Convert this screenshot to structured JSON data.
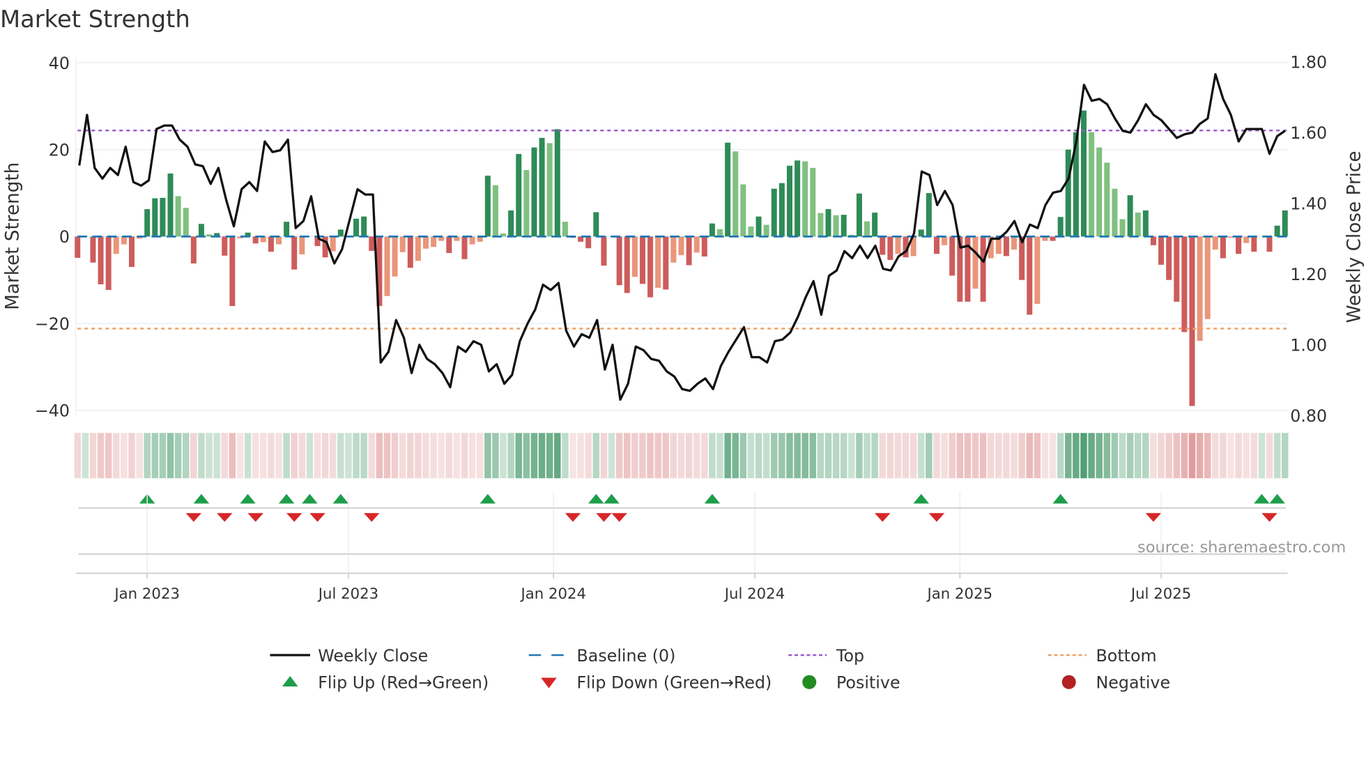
{
  "chart_data": {
    "type": "bar",
    "title": "Market Strength",
    "ylabel": "Market Strength",
    "y2label": "Weekly Close Price",
    "ylim": [
      -40,
      40
    ],
    "y2lim": [
      0.8,
      1.8
    ],
    "yticks": [
      40,
      20,
      0,
      -20,
      -40
    ],
    "ytick_labels": [
      "40",
      "20",
      "0",
      "−20",
      "−40"
    ],
    "y2ticks": [
      1.8,
      1.6,
      1.4,
      1.2,
      1.0,
      0.8
    ],
    "y2tick_labels": [
      "1.80",
      "1.60",
      "1.40",
      "1.20",
      "1.00",
      "0.80"
    ],
    "xtick_labels": [
      "Jan 2023",
      "Jul 2023",
      "Jan 2024",
      "Jul 2024",
      "Jan 2025",
      "Jul 2025"
    ],
    "xtick_week_index": [
      9,
      35,
      61.5,
      87.5,
      114,
      140
    ],
    "top_line": 24.4,
    "bottom_line": -21.2,
    "baseline": 0,
    "strength": [
      -4.9,
      0,
      -6,
      -11,
      -12.3,
      -4,
      -1.8,
      -7,
      -0.5,
      6.3,
      8.8,
      8.9,
      14.5,
      9.3,
      6.6,
      -6.2,
      2.9,
      0.5,
      0.8,
      -4.4,
      -16,
      -0.4,
      0.9,
      -1.6,
      -1.3,
      -3.5,
      -1.8,
      3.4,
      -7.6,
      -4.1,
      0,
      -2.2,
      -4.8,
      -3.4,
      1.6,
      0.1,
      4.1,
      4.6,
      -3.3,
      -16,
      -13.7,
      -9.2,
      -3.6,
      -7.2,
      -5.6,
      -2.8,
      -2.4,
      -1,
      -3.8,
      -1,
      -5.2,
      -1.8,
      -1.2,
      14,
      11.8,
      0.7,
      6,
      19,
      15.3,
      20.5,
      22.7,
      21.5,
      24.7,
      3.4,
      -0.3,
      -1.2,
      -2.7,
      5.6,
      -6.7,
      0,
      -11.2,
      -13,
      -9.3,
      -10.9,
      -14,
      -11.8,
      -12.2,
      -6,
      -4.3,
      -6.6,
      -3.7,
      -4.6,
      3,
      1.7,
      21.6,
      19.6,
      12,
      2.3,
      4.6,
      2.7,
      11,
      12.3,
      16.3,
      17.5,
      17.3,
      15.8,
      5.4,
      6.3,
      4.9,
      5,
      0.4,
      9.9,
      3.5,
      5.5,
      -4.2,
      -5.4,
      -4,
      -4.8,
      -4.5,
      1.6,
      10,
      -4,
      -2,
      -9,
      -15,
      -15,
      -12,
      -15,
      -5,
      -4,
      -4.5,
      -3,
      -10,
      -18,
      -15.5,
      -1,
      -1,
      4.5,
      20,
      24,
      29,
      24,
      20.5,
      17,
      11,
      4,
      9.5,
      5.5,
      6,
      -2,
      -6.5,
      -10,
      -15,
      -22,
      -39,
      -24,
      -19,
      -3,
      -5,
      -0.3,
      -4,
      -1.5,
      -3.5,
      0,
      -3.5,
      2.5,
      6
    ],
    "weekly_close": [
      1.507,
      1.65,
      1.5,
      1.47,
      1.5,
      1.48,
      1.56,
      1.46,
      1.45,
      1.465,
      1.61,
      1.62,
      1.62,
      1.58,
      1.56,
      1.51,
      1.505,
      1.455,
      1.5,
      1.41,
      1.335,
      1.44,
      1.46,
      1.435,
      1.575,
      1.545,
      1.55,
      1.58,
      1.33,
      1.35,
      1.42,
      1.3,
      1.29,
      1.23,
      1.27,
      1.355,
      1.44,
      1.425,
      1.425,
      0.95,
      0.98,
      1.07,
      1.02,
      0.92,
      1.0,
      0.96,
      0.945,
      0.92,
      0.88,
      0.995,
      0.98,
      1.01,
      1.0,
      0.925,
      0.945,
      0.89,
      0.915,
      1.01,
      1.06,
      1.1,
      1.17,
      1.155,
      1.175,
      1.04,
      0.995,
      1.03,
      1.02,
      1.07,
      0.93,
      1.0,
      0.845,
      0.89,
      0.995,
      0.985,
      0.96,
      0.955,
      0.925,
      0.91,
      0.875,
      0.87,
      0.89,
      0.905,
      0.875,
      0.94,
      0.98,
      1.015,
      1.05,
      0.965,
      0.965,
      0.95,
      1.01,
      1.015,
      1.035,
      1.08,
      1.135,
      1.18,
      1.085,
      1.195,
      1.21,
      1.265,
      1.245,
      1.28,
      1.245,
      1.28,
      1.215,
      1.21,
      1.25,
      1.265,
      1.315,
      1.49,
      1.48,
      1.395,
      1.435,
      1.395,
      1.275,
      1.28,
      1.26,
      1.235,
      1.3,
      1.3,
      1.32,
      1.35,
      1.29,
      1.34,
      1.33,
      1.395,
      1.43,
      1.435,
      1.47,
      1.575,
      1.735,
      1.69,
      1.695,
      1.68,
      1.64,
      1.605,
      1.6,
      1.635,
      1.68,
      1.65,
      1.635,
      1.61,
      1.585,
      1.595,
      1.6,
      1.625,
      1.64,
      1.765,
      1.695,
      1.65,
      1.575,
      1.61,
      1.61,
      1.61,
      1.54,
      1.59,
      1.605
    ],
    "flip_up_week_index": [
      9,
      16,
      22,
      27,
      30,
      34,
      53,
      67,
      69,
      82,
      109,
      127,
      153,
      155
    ],
    "flip_down_week_index": [
      15,
      19,
      23,
      28,
      31,
      38,
      64,
      68,
      70,
      104,
      111,
      139,
      154
    ],
    "legend": {
      "placement": "bottom",
      "items": [
        {
          "label": "Weekly Close",
          "kind": "line-solid"
        },
        {
          "label": "Baseline (0)",
          "kind": "line-dashed"
        },
        {
          "label": "Top",
          "kind": "line-dotted-top"
        },
        {
          "label": "Bottom",
          "kind": "line-dotted-bottom"
        },
        {
          "label": "Flip Up (Red→Green)",
          "kind": "triangle-up"
        },
        {
          "label": "Flip Down (Green→Red)",
          "kind": "triangle-down"
        },
        {
          "label": "Positive",
          "kind": "circle-positive"
        },
        {
          "label": "Negative",
          "kind": "circle-negative"
        }
      ]
    },
    "annotation": "source: sharemaestro.com",
    "colors": {
      "pos_strong": "#2e8b57",
      "pos_weak": "#80c080",
      "neg_strong": "#cd5c5c",
      "neg_weak": "#e9967a",
      "close": "#111111",
      "baseline": "#1f77b4",
      "top": "#9b59d0",
      "bottom": "#f0a060",
      "flip_up": "#1e9e4a",
      "flip_down": "#d62728",
      "positive": "#228b22",
      "negative": "#b22222",
      "grid": "#eceef2"
    }
  }
}
